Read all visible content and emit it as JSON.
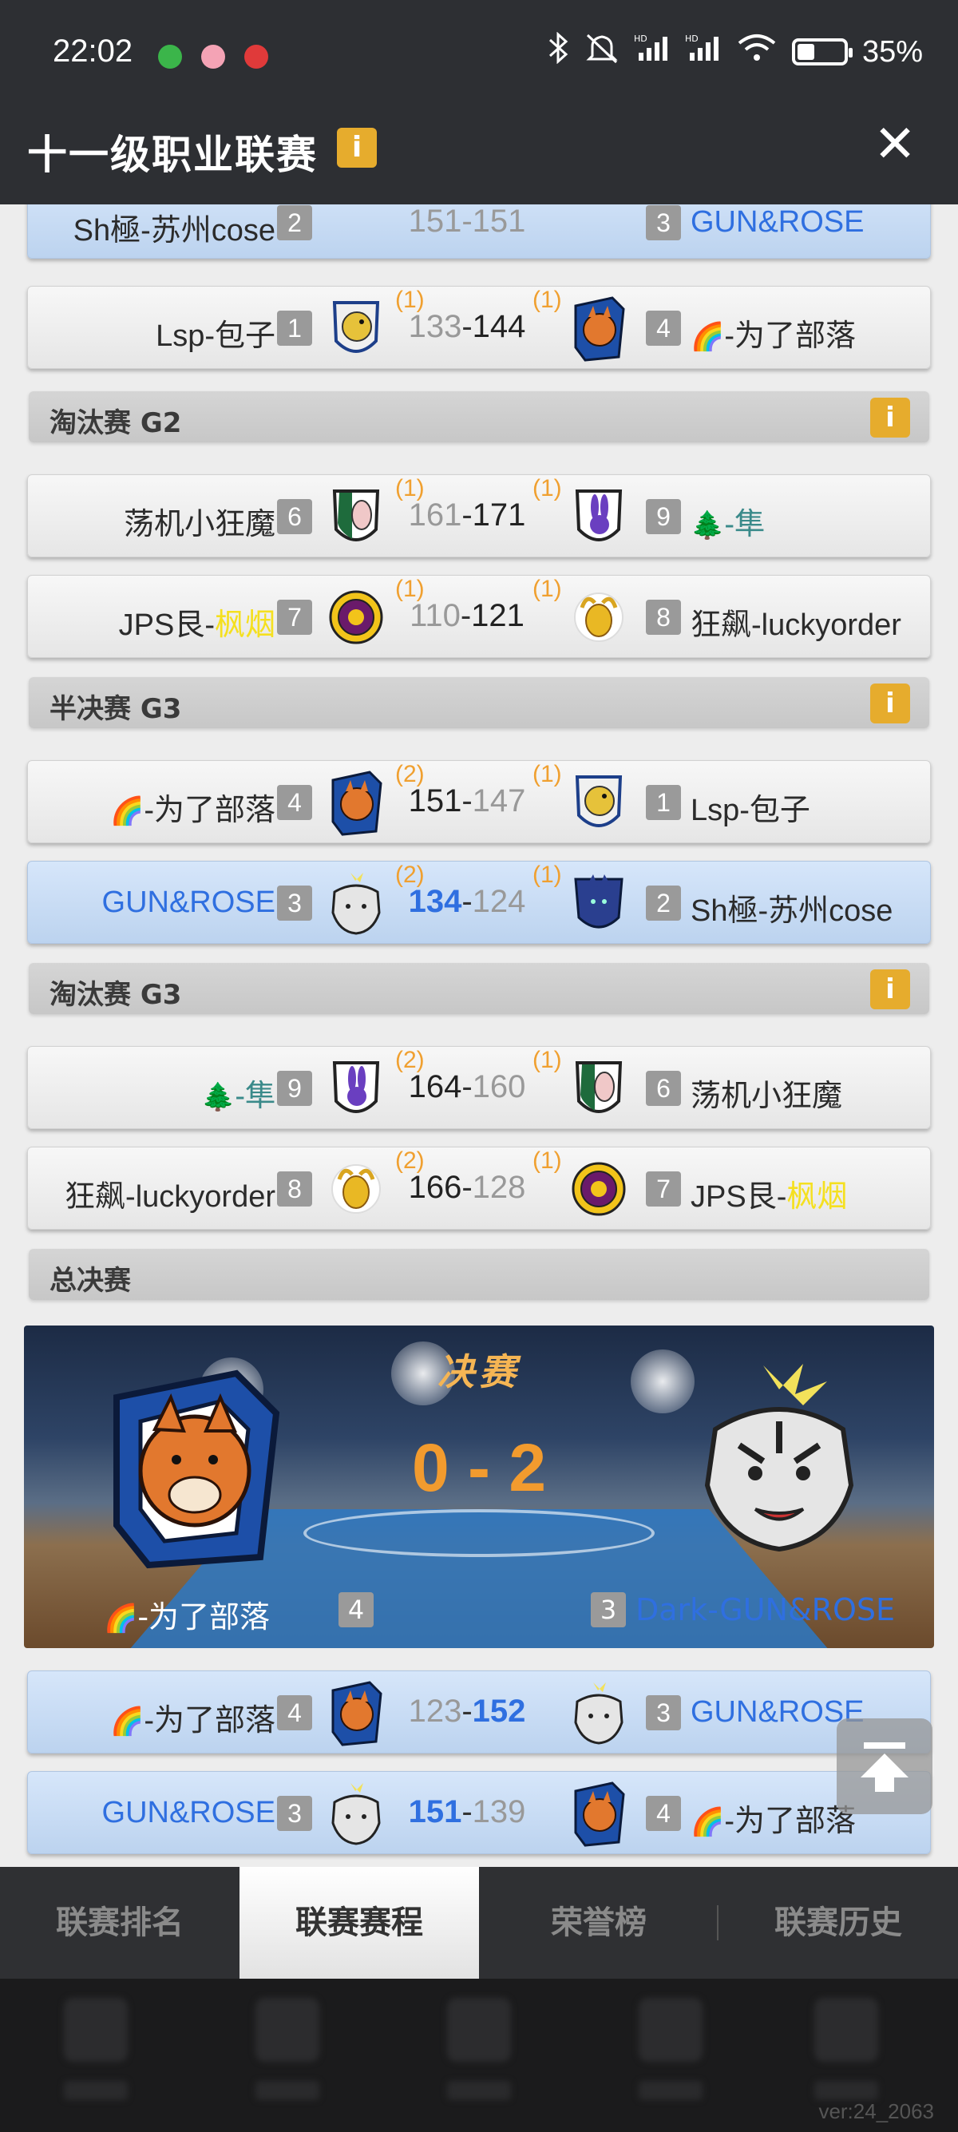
{
  "status_bar": {
    "time": "22:02",
    "battery": "35%",
    "battery_level": 0.35,
    "icons": [
      "wechat-icon",
      "app-icon",
      "xiaohongshu-icon",
      "bluetooth-icon",
      "mute-icon",
      "hd-signal-icon",
      "hd-signal-icon",
      "wifi-icon",
      "battery-icon"
    ]
  },
  "header": {
    "title": "十一级职业联赛",
    "info": "i",
    "close": "✕"
  },
  "top_partial": {
    "left_name": "Sh極-苏州cose",
    "left_seed": "2",
    "score": "151-151",
    "right_seed": "3",
    "right_name": "GUN&ROSE"
  },
  "matches": [
    {
      "lname_pre": "",
      "lname": "Lsp-包子",
      "lseed": "1",
      "lwins": "(1)",
      "ls": "133",
      "rs": "144",
      "rwins": "(1)",
      "rseed": "4",
      "rname_pre": "🌈",
      "rname": "-为了部落",
      "winner": "r",
      "hl": false
    },
    {
      "lname_pre": "",
      "lname": "荡机小狂魔",
      "lseed": "6",
      "lwins": "(1)",
      "ls": "161",
      "rs": "171",
      "rwins": "(1)",
      "rseed": "9",
      "rname_pre": "🌲",
      "rname": "-隼",
      "winner": "r",
      "hl": false
    },
    {
      "lname_pre": "JPS艮-",
      "lname": "枫烟",
      "lseed": "7",
      "lwins": "(1)",
      "ls": "110",
      "rs": "121",
      "rwins": "(1)",
      "rseed": "8",
      "rname_pre": "",
      "rname": "狂飙-luckyorder",
      "winner": "r",
      "hl": false
    },
    {
      "lname_pre": "🌈",
      "lname": "-为了部落",
      "lseed": "4",
      "lwins": "(2)",
      "ls": "151",
      "rs": "147",
      "rwins": "(1)",
      "rseed": "1",
      "rname_pre": "",
      "rname": "Lsp-包子",
      "winner": "l",
      "hl": false
    },
    {
      "lname_pre": "",
      "lname": "GUN&ROSE",
      "lseed": "3",
      "lwins": "(2)",
      "ls": "134",
      "rs": "124",
      "rwins": "(1)",
      "rseed": "2",
      "rname_pre": "",
      "rname": "Sh極-苏州cose",
      "winner": "l",
      "hl": true
    },
    {
      "lname_pre": "🌲",
      "lname": "-隼",
      "lseed": "9",
      "lwins": "(2)",
      "ls": "164",
      "rs": "160",
      "rwins": "(1)",
      "rseed": "6",
      "rname_pre": "",
      "rname": "荡机小狂魔",
      "winner": "l",
      "hl": false
    },
    {
      "lname_pre": "",
      "lname": "狂飙-luckyorder",
      "lseed": "8",
      "lwins": "(2)",
      "ls": "166",
      "rs": "128",
      "rwins": "(1)",
      "rseed": "7",
      "rname_pre": "JPS艮-",
      "rname": "枫烟",
      "winner": "l",
      "hl": false
    },
    {
      "lname_pre": "🌈",
      "lname": "-为了部落",
      "lseed": "4",
      "lwins": "",
      "ls": "123",
      "rs": "152",
      "rwins": "",
      "rseed": "3",
      "rname_pre": "",
      "rname": "GUN&ROSE",
      "winner": "r",
      "hl": true
    },
    {
      "lname_pre": "",
      "lname": "GUN&ROSE",
      "lseed": "3",
      "lwins": "",
      "ls": "151",
      "rs": "139",
      "rwins": "",
      "rseed": "4",
      "rname_pre": "🌈",
      "rname": "-为了部落",
      "winner": "l",
      "hl": true
    }
  ],
  "sections": {
    "elim_g2": "淘汰赛 G2",
    "semi_g3": "半决赛 G3",
    "elim_g3": "淘汰赛 G3",
    "final": "总决赛",
    "info": "i"
  },
  "finals": {
    "title": "决赛",
    "score": "0 - 2",
    "left_emoji": "🌈",
    "left_name": "-为了部落",
    "left_seed": "4",
    "right_seed": "3",
    "right_name": "Dark-GUN&ROSE"
  },
  "tabs": [
    "联赛排名",
    "联赛赛程",
    "荣誉榜",
    "联赛历史"
  ],
  "active_tab": 1,
  "version": "ver:24_2063",
  "colors": {
    "winner_blue": "#2f6fe0",
    "accent_orange": "#f0a030",
    "info_yellow": "#e6ac2d",
    "header_bg": "#2d2f33"
  }
}
